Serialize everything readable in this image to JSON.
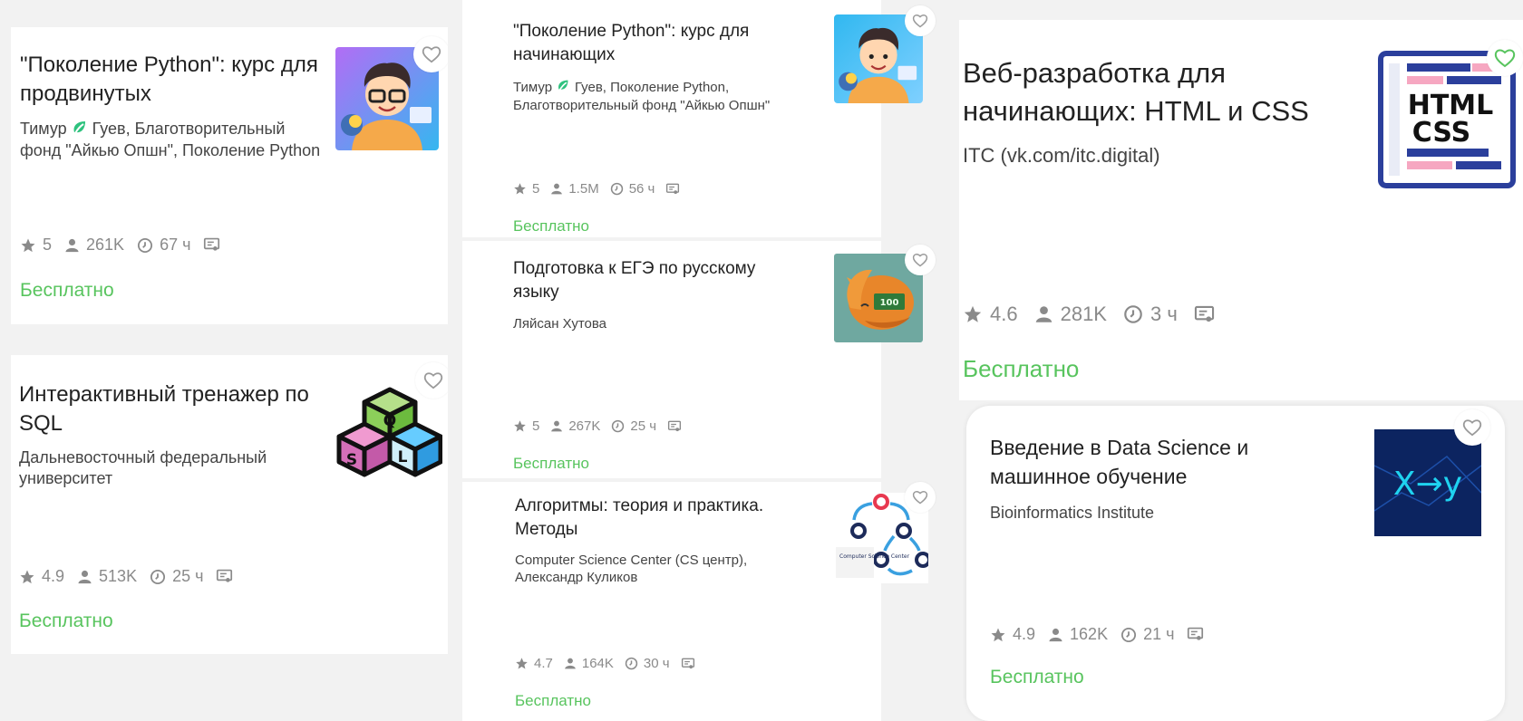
{
  "colors": {
    "accent_green": "#58c45e",
    "muted": "#8a8a8a",
    "heart_outline": "#9a9a9a"
  },
  "cards": [
    {
      "title": "\"Поколение Python\": курс для продвинутых",
      "author_first": "Тимур",
      "author_rest": "Гуев, Благотворительный фонд \"Айкью Опшн\", Поколение Python",
      "rating": "5",
      "learners": "261K",
      "hours": "67 ч",
      "price": "Бесплатно",
      "thumb_icon": "python-student-avatar"
    },
    {
      "title": "Интерактивный тренажер по SQL",
      "authors": "Дальневосточный федеральный университет",
      "rating": "4.9",
      "learners": "513K",
      "hours": "25 ч",
      "price": "Бесплатно",
      "thumb_icon": "sql-cubes-logo",
      "thumb_letters": [
        "Q",
        "S",
        "L"
      ]
    },
    {
      "title": "\"Поколение Python\": курс для начинающих",
      "author_first": "Тимур",
      "author_rest": "Гуев, Поколение Python, Благотворительный фонд \"Айкью Опшн\"",
      "rating": "5",
      "learners": "1.5M",
      "hours": "56 ч",
      "price": "Бесплатно",
      "thumb_icon": "python-student-avatar"
    },
    {
      "title": "Подготовка к ЕГЭ по русскому языку",
      "authors": "Ляйсан Хутова",
      "rating": "5",
      "learners": "267K",
      "hours": "25 ч",
      "price": "Бесплатно",
      "thumb_icon": "sleeping-fox-image",
      "thumb_badge": "100"
    },
    {
      "title": "Алгоритмы: теория и практика. Методы",
      "authors": "Computer Science Center (CS центр), Александр Куликов",
      "rating": "4.7",
      "learners": "164K",
      "hours": "30 ч",
      "price": "Бесплатно",
      "thumb_icon": "algorithm-graph-logo",
      "thumb_logo_text": "Computer Science Center"
    },
    {
      "title": "Веб-разработка для начинающих: HTML и CSS",
      "authors": "ITC (vk.com/itc.digital)",
      "rating": "4.6",
      "learners": "281K",
      "hours": "3 ч",
      "price": "Бесплатно",
      "thumb_icon": "html-css-document",
      "thumb_lines": [
        "HTML",
        "CSS"
      ]
    },
    {
      "title": "Введение в Data Science и машинное обучение",
      "authors": "Bioinformatics Institute",
      "rating": "4.9",
      "learners": "162K",
      "hours": "21 ч",
      "price": "Бесплатно",
      "thumb_icon": "x-to-y-logo",
      "thumb_text": "X→y"
    }
  ]
}
